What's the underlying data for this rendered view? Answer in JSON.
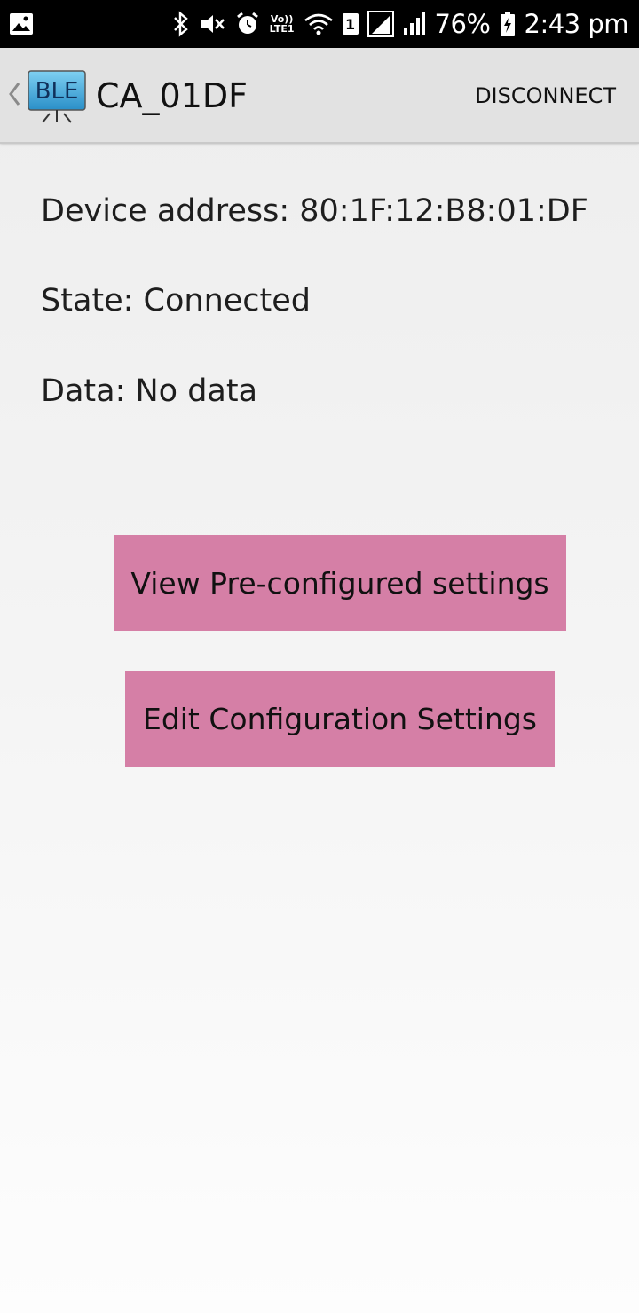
{
  "status_bar": {
    "icons": [
      "gallery-notification-icon",
      "bluetooth-icon",
      "mute-icon",
      "alarm-icon",
      "volte-icon",
      "wifi-icon",
      "sim1-icon",
      "signal-icon",
      "signal-icon-2",
      "battery-icon"
    ],
    "volte_top": "Vo))",
    "volte_bottom": "LTE1",
    "sim_label": "1",
    "battery": "76%",
    "time": "2:43 pm"
  },
  "app_bar": {
    "logo_text": "BLE",
    "title": "CA_01DF",
    "action_label": "DISCONNECT",
    "background": "#e2e2e2"
  },
  "device": {
    "address_line": "Device address: 80:1F:12:B8:01:DF",
    "state_line": "State: Connected",
    "data_line": "Data: No data"
  },
  "buttons": {
    "view_label": "View Pre-configured settings",
    "edit_label": "Edit Configuration Settings",
    "color": "#d57fa6"
  }
}
